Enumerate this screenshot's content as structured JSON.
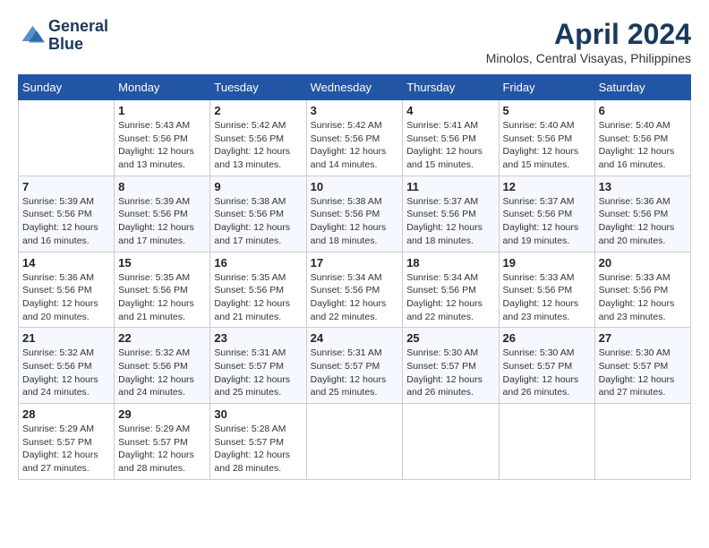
{
  "header": {
    "logo_line1": "General",
    "logo_line2": "Blue",
    "month_year": "April 2024",
    "location": "Minolos, Central Visayas, Philippines"
  },
  "days_of_week": [
    "Sunday",
    "Monday",
    "Tuesday",
    "Wednesday",
    "Thursday",
    "Friday",
    "Saturday"
  ],
  "weeks": [
    [
      null,
      {
        "day": 1,
        "sunrise": "5:43 AM",
        "sunset": "5:56 PM",
        "daylight": "12 hours and 13 minutes."
      },
      {
        "day": 2,
        "sunrise": "5:42 AM",
        "sunset": "5:56 PM",
        "daylight": "12 hours and 13 minutes."
      },
      {
        "day": 3,
        "sunrise": "5:42 AM",
        "sunset": "5:56 PM",
        "daylight": "12 hours and 14 minutes."
      },
      {
        "day": 4,
        "sunrise": "5:41 AM",
        "sunset": "5:56 PM",
        "daylight": "12 hours and 15 minutes."
      },
      {
        "day": 5,
        "sunrise": "5:40 AM",
        "sunset": "5:56 PM",
        "daylight": "12 hours and 15 minutes."
      },
      {
        "day": 6,
        "sunrise": "5:40 AM",
        "sunset": "5:56 PM",
        "daylight": "12 hours and 16 minutes."
      }
    ],
    [
      {
        "day": 7,
        "sunrise": "5:39 AM",
        "sunset": "5:56 PM",
        "daylight": "12 hours and 16 minutes."
      },
      {
        "day": 8,
        "sunrise": "5:39 AM",
        "sunset": "5:56 PM",
        "daylight": "12 hours and 17 minutes."
      },
      {
        "day": 9,
        "sunrise": "5:38 AM",
        "sunset": "5:56 PM",
        "daylight": "12 hours and 17 minutes."
      },
      {
        "day": 10,
        "sunrise": "5:38 AM",
        "sunset": "5:56 PM",
        "daylight": "12 hours and 18 minutes."
      },
      {
        "day": 11,
        "sunrise": "5:37 AM",
        "sunset": "5:56 PM",
        "daylight": "12 hours and 18 minutes."
      },
      {
        "day": 12,
        "sunrise": "5:37 AM",
        "sunset": "5:56 PM",
        "daylight": "12 hours and 19 minutes."
      },
      {
        "day": 13,
        "sunrise": "5:36 AM",
        "sunset": "5:56 PM",
        "daylight": "12 hours and 20 minutes."
      }
    ],
    [
      {
        "day": 14,
        "sunrise": "5:36 AM",
        "sunset": "5:56 PM",
        "daylight": "12 hours and 20 minutes."
      },
      {
        "day": 15,
        "sunrise": "5:35 AM",
        "sunset": "5:56 PM",
        "daylight": "12 hours and 21 minutes."
      },
      {
        "day": 16,
        "sunrise": "5:35 AM",
        "sunset": "5:56 PM",
        "daylight": "12 hours and 21 minutes."
      },
      {
        "day": 17,
        "sunrise": "5:34 AM",
        "sunset": "5:56 PM",
        "daylight": "12 hours and 22 minutes."
      },
      {
        "day": 18,
        "sunrise": "5:34 AM",
        "sunset": "5:56 PM",
        "daylight": "12 hours and 22 minutes."
      },
      {
        "day": 19,
        "sunrise": "5:33 AM",
        "sunset": "5:56 PM",
        "daylight": "12 hours and 23 minutes."
      },
      {
        "day": 20,
        "sunrise": "5:33 AM",
        "sunset": "5:56 PM",
        "daylight": "12 hours and 23 minutes."
      }
    ],
    [
      {
        "day": 21,
        "sunrise": "5:32 AM",
        "sunset": "5:56 PM",
        "daylight": "12 hours and 24 minutes."
      },
      {
        "day": 22,
        "sunrise": "5:32 AM",
        "sunset": "5:56 PM",
        "daylight": "12 hours and 24 minutes."
      },
      {
        "day": 23,
        "sunrise": "5:31 AM",
        "sunset": "5:57 PM",
        "daylight": "12 hours and 25 minutes."
      },
      {
        "day": 24,
        "sunrise": "5:31 AM",
        "sunset": "5:57 PM",
        "daylight": "12 hours and 25 minutes."
      },
      {
        "day": 25,
        "sunrise": "5:30 AM",
        "sunset": "5:57 PM",
        "daylight": "12 hours and 26 minutes."
      },
      {
        "day": 26,
        "sunrise": "5:30 AM",
        "sunset": "5:57 PM",
        "daylight": "12 hours and 26 minutes."
      },
      {
        "day": 27,
        "sunrise": "5:30 AM",
        "sunset": "5:57 PM",
        "daylight": "12 hours and 27 minutes."
      }
    ],
    [
      {
        "day": 28,
        "sunrise": "5:29 AM",
        "sunset": "5:57 PM",
        "daylight": "12 hours and 27 minutes."
      },
      {
        "day": 29,
        "sunrise": "5:29 AM",
        "sunset": "5:57 PM",
        "daylight": "12 hours and 28 minutes."
      },
      {
        "day": 30,
        "sunrise": "5:28 AM",
        "sunset": "5:57 PM",
        "daylight": "12 hours and 28 minutes."
      },
      null,
      null,
      null,
      null
    ]
  ],
  "labels": {
    "sunrise": "Sunrise:",
    "sunset": "Sunset:",
    "daylight": "Daylight:"
  }
}
